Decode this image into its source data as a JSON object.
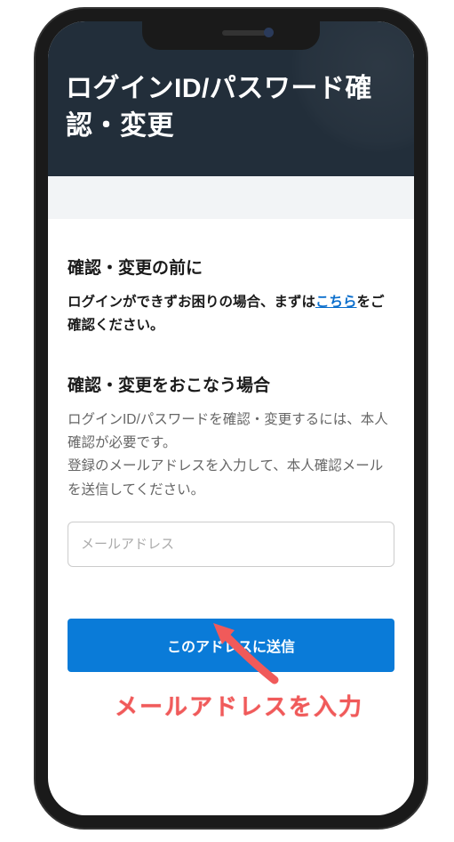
{
  "header": {
    "title": "ログインID/パスワード確認・変更"
  },
  "section1": {
    "title": "確認・変更の前に",
    "text_before": "ログインができずお困りの場合、まずは",
    "link_text": "こちら",
    "text_after": "をご確認ください。"
  },
  "section2": {
    "title": "確認・変更をおこなう場合",
    "desc1": "ログインID/パスワードを確認・変更するには、本人確認が必要です。",
    "desc2": "登録のメールアドレスを入力して、本人確認メールを送信してください。"
  },
  "form": {
    "email_placeholder": "メールアドレス",
    "submit_label": "このアドレスに送信"
  },
  "annotation": {
    "text": "メールアドレスを入力"
  }
}
